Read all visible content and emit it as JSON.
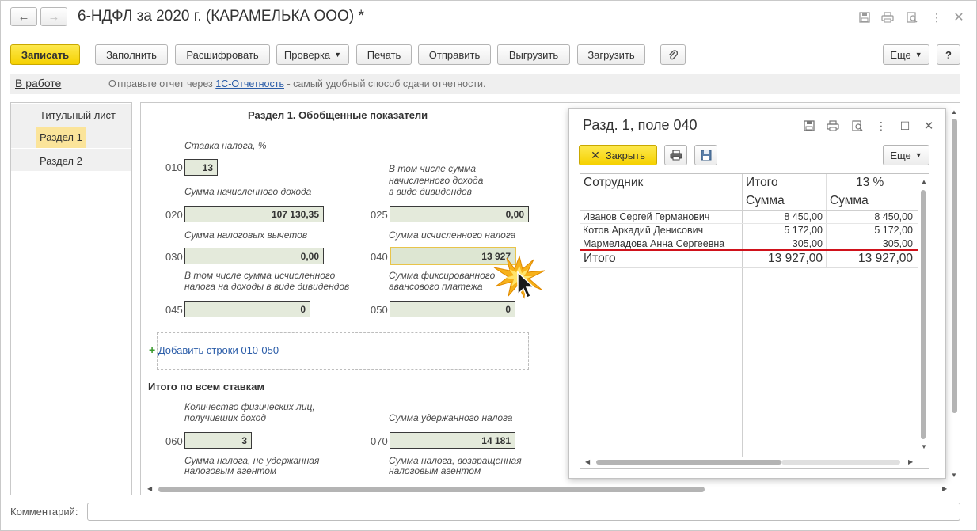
{
  "window": {
    "title": "6-НДФЛ за 2020 г. (КАРАМЕЛЬКА ООО) *"
  },
  "toolbar": {
    "save": "Записать",
    "fill": "Заполнить",
    "decode": "Расшифровать",
    "check": "Проверка",
    "print": "Печать",
    "send": "Отправить",
    "export": "Выгрузить",
    "import": "Загрузить",
    "more": "Еще",
    "help": "?"
  },
  "status": {
    "state_link": "В работе",
    "message_before": "Отправьте отчет через ",
    "message_link": "1С-Отчетность",
    "message_after": " - самый удобный способ сдачи отчетности."
  },
  "sidebar": {
    "items": [
      "Титульный лист",
      "Раздел 1",
      "Раздел 2"
    ]
  },
  "section1": {
    "title": "Раздел 1. Обобщенные показатели",
    "tax_rate_label": "Ставка налога, %",
    "f010_code": "010",
    "f010_value": "13",
    "income_label": "Сумма начисленного дохода",
    "f020_code": "020",
    "f020_value": "107 130,35",
    "dividends_l1": "В том числе сумма",
    "dividends_l2": "начисленного дохода",
    "dividends_l3": "в виде дивидендов",
    "f025_code": "025",
    "f025_value": "0,00",
    "deductions_label": "Сумма налоговых вычетов",
    "f030_code": "030",
    "f030_value": "0,00",
    "calc_tax_label": "Сумма исчисленного налога",
    "f040_code": "040",
    "f040_value": "13 927",
    "div_tax_l1": "В том числе сумма исчисленного",
    "div_tax_l2": "налога на доходы в виде дивидендов",
    "fixed_l1": "Сумма фиксированного",
    "fixed_l2": "авансового платежа",
    "f045_code": "045",
    "f045_value": "0",
    "f050_code": "050",
    "f050_value": "0",
    "add_rows": "Добавить строки 010-050"
  },
  "totals": {
    "title": "Итого по всем ставкам",
    "persons_l1": "Количество физических лиц,",
    "persons_l2": "получивших доход",
    "f060_code": "060",
    "f060_value": "3",
    "withheld_label": "Сумма удержанного налога",
    "f070_code": "070",
    "f070_value": "14 181",
    "not_withheld_l1": "Сумма налога, не удержанная",
    "not_withheld_l2": "налоговым агентом",
    "returned_l1": "Сумма налога, возвращенная",
    "returned_l2": "налоговым агентом"
  },
  "popup": {
    "title": "Разд. 1, поле 040",
    "close": "Закрыть",
    "more": "Еще",
    "col_employee": "Сотрудник",
    "col_total": "Итого",
    "col_rate": "13 %",
    "col_sum1": "Сумма",
    "col_sum2": "Сумма",
    "rows": [
      {
        "name": "Иванов Сергей Германович",
        "total": "8 450,00",
        "rate": "8 450,00"
      },
      {
        "name": "Котов Аркадий Денисович",
        "total": "5 172,00",
        "rate": "5 172,00"
      },
      {
        "name": "Мармеладова Анна Сергеевна",
        "total": "305,00",
        "rate": "305,00"
      }
    ],
    "footer_label": "Итого",
    "footer_total": "13 927,00",
    "footer_rate": "13 927,00"
  },
  "comment": {
    "label": "Комментарий:",
    "value": ""
  },
  "colors": {
    "accent_yellow": "#f5d100",
    "field_bg": "#e4eadb",
    "link_blue": "#2a5ca8",
    "underline_red": "#d0121b"
  }
}
